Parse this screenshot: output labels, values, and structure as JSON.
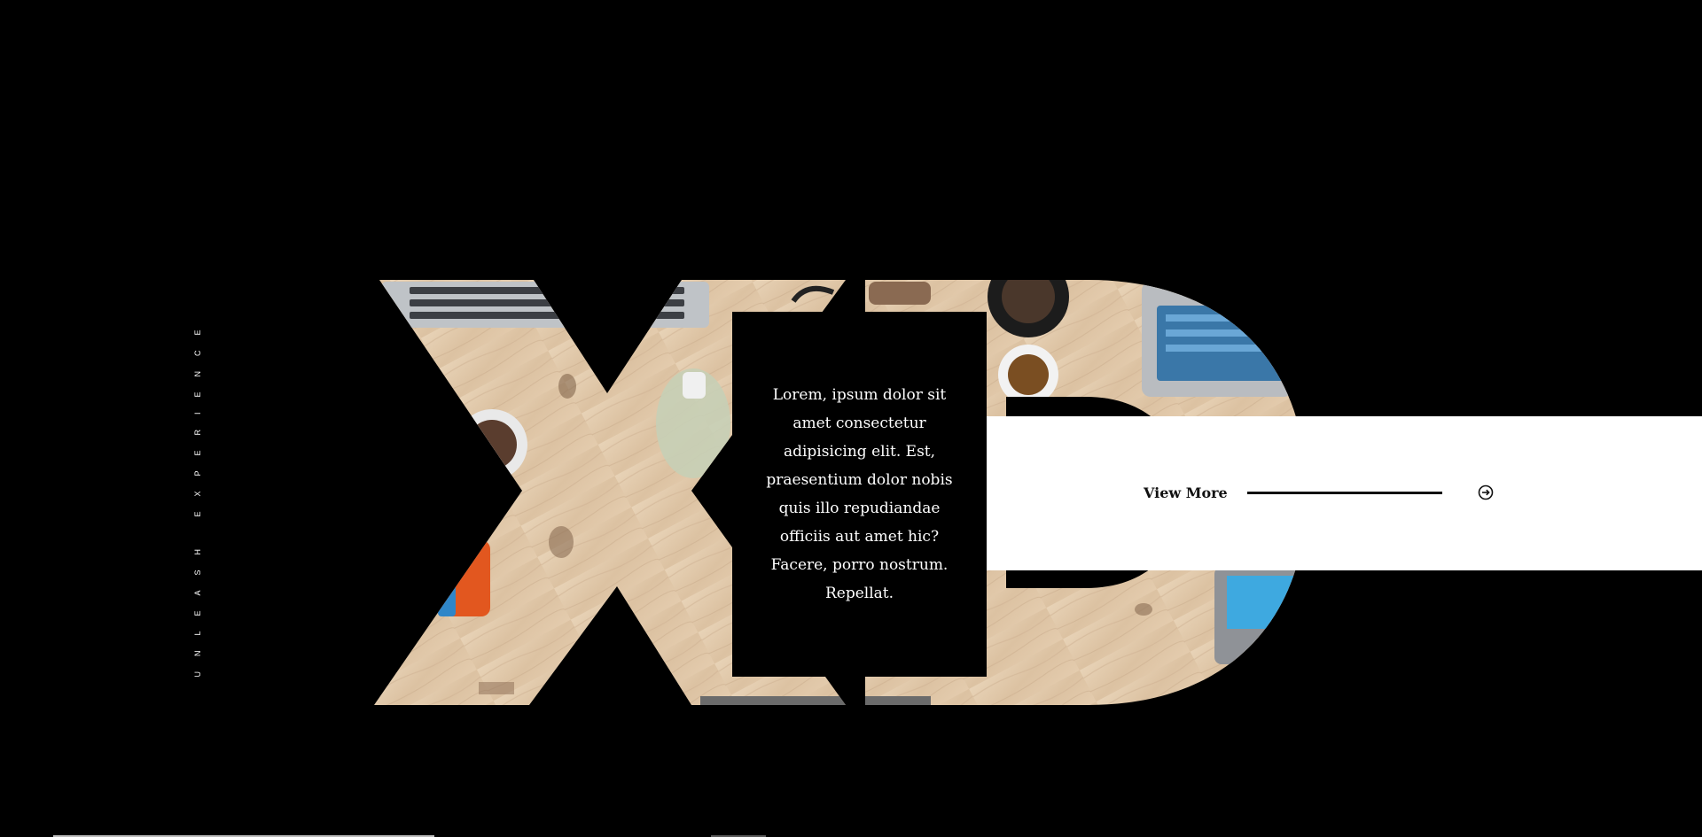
{
  "hero": {
    "brand_letters": "XD",
    "tagline": "UNLEASH EXPERIENCE"
  },
  "card": {
    "text": "Lorem, ipsum dolor sit amet consectetur adipisicing elit. Est, praesentium dolor nobis quis illo repudiandae officiis aut amet hic? Facere, porro nostrum. Repellat."
  },
  "cta": {
    "label": "View More",
    "icon": "arrow-circle-right-icon"
  },
  "colors": {
    "background": "#000000",
    "band": "#ffffff",
    "text_dark": "#111111",
    "text_light": "#ffffff",
    "wood_light": "#e6d0b4",
    "wood_dark": "#c9a98a"
  }
}
